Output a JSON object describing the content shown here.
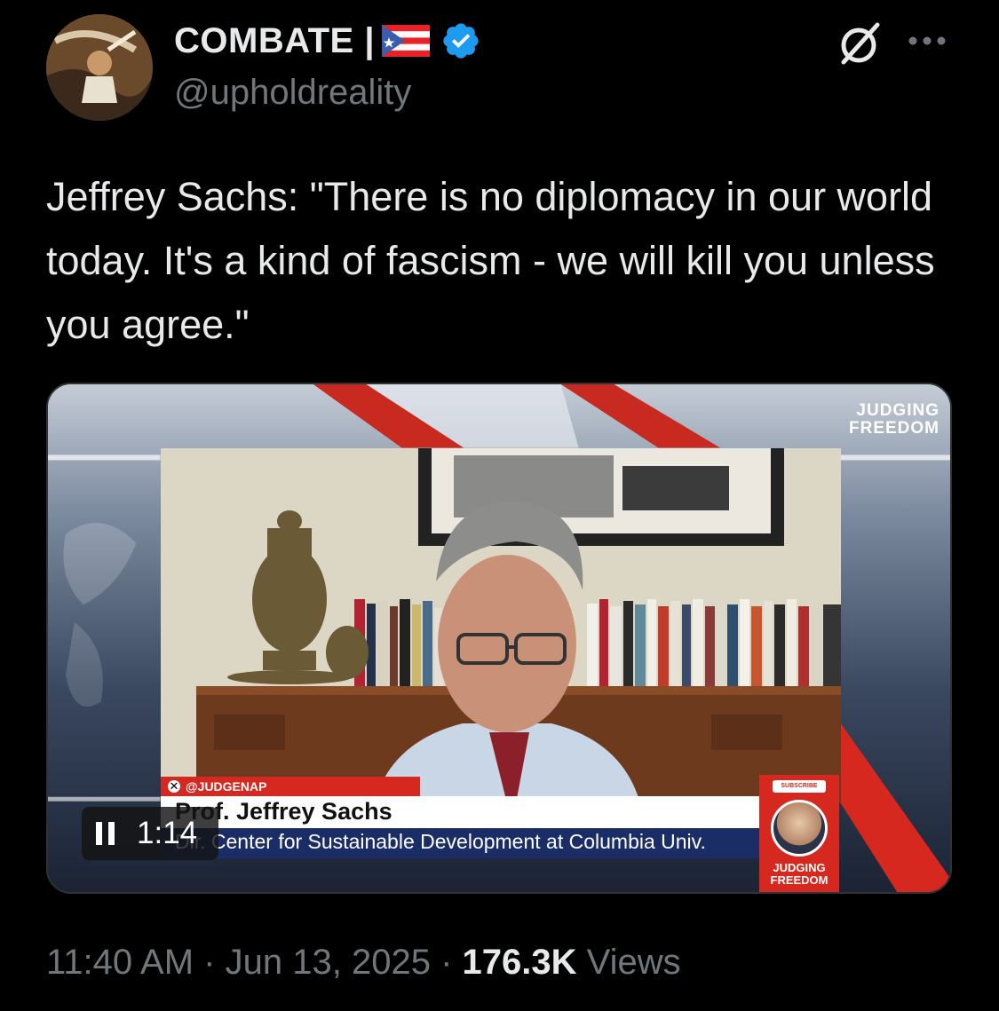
{
  "author": {
    "display_name": "COMBATE |",
    "handle": "@upholdreality",
    "flag_icon": "puerto-rico-flag-icon",
    "verified_icon": "verified-badge-icon",
    "verified_color": "#1d9bf0"
  },
  "header_actions": {
    "grok_icon": "grok-icon",
    "more_icon": "more-icon"
  },
  "tweet": {
    "text": "Jeffrey Sachs: \"There is no diplomacy in our world today. It's a kind of fascism - we will kill you unless you agree.\""
  },
  "video": {
    "brand_line1": "JUDGING",
    "brand_line2": "FREEDOM",
    "tag": "@JUDGENAP",
    "guest_name": "Prof. Jeffrey Sachs",
    "guest_title": "Dir. Center for Sustainable Development at Columbia Univ.",
    "subscribe_label": "SUBSCRIBE",
    "badge_brand_line1": "JUDGING",
    "badge_brand_line2": "FREEDOM",
    "time": "1:14",
    "pause_icon": "pause-icon"
  },
  "meta": {
    "time": "11:40 AM",
    "separator": "·",
    "date": "Jun 13, 2025",
    "views_count": "176.3K",
    "views_label": "Views"
  },
  "colors": {
    "background": "#000000",
    "text_primary": "#e7e9ea",
    "text_secondary": "#71767b",
    "accent_red": "#d7281f"
  }
}
